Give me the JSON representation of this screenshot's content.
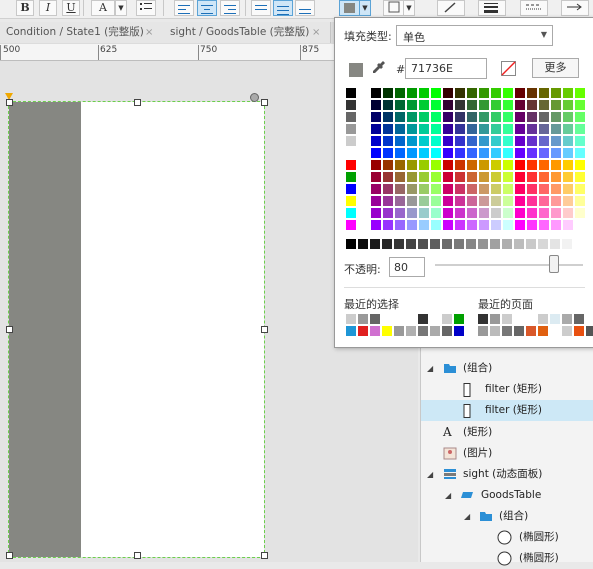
{
  "toolbar": {
    "bold_label": "B",
    "italic_label": "I",
    "underline_label": "U",
    "font_color_label": "A",
    "fill_color": "#868782"
  },
  "tabs": [
    {
      "label": "Condition / State1 (完整版)",
      "close": "×"
    },
    {
      "label": "sight / GoodsTable (完整版)",
      "close": "×"
    }
  ],
  "ruler": {
    "labels": [
      "500",
      "625",
      "750",
      "875"
    ]
  },
  "fill_picker": {
    "fill_type_label": "填充类型:",
    "fill_type_value": "单色",
    "hash_label": "#",
    "hex_value": "71736E",
    "more_button": "更多",
    "opacity_label": "不透明:",
    "opacity_value": "80",
    "opacity_percent": 80,
    "recent_colors_label": "最近的选择",
    "recent_pages_label": "最近的页面",
    "current_color": "#868782"
  },
  "outline": {
    "items": [
      {
        "label": "(组合)",
        "icon": "folder-icon"
      },
      {
        "label": "filter (矩形)",
        "icon": "rectangle-icon"
      },
      {
        "label": "filter (矩形)",
        "icon": "rectangle-icon",
        "selected": true
      },
      {
        "label": "(矩形)",
        "icon": "text-icon"
      },
      {
        "label": "(图片)",
        "icon": "image-icon"
      },
      {
        "label": "sight (动态面板)",
        "icon": "dynamic-panel-icon"
      },
      {
        "label": "GoodsTable",
        "icon": "state-icon"
      },
      {
        "label": "(组合)",
        "icon": "folder-icon"
      },
      {
        "label": "(椭圆形)",
        "icon": "ellipse-icon"
      },
      {
        "label": "(椭圆形)",
        "icon": "ellipse-icon"
      }
    ]
  }
}
